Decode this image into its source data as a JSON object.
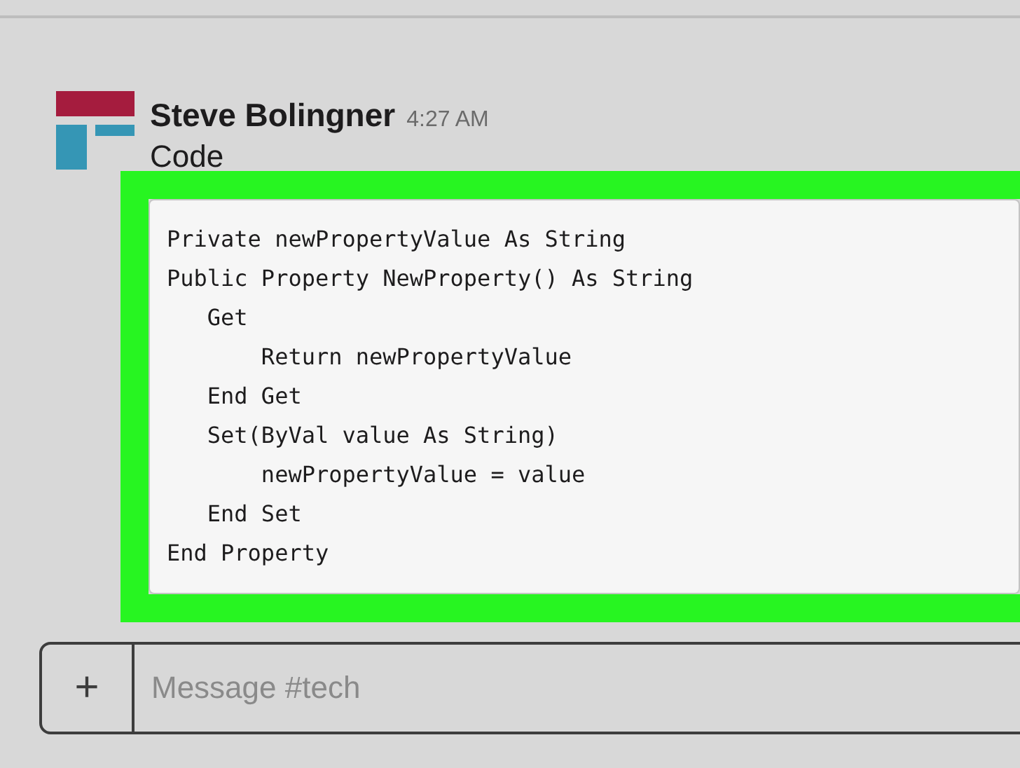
{
  "message": {
    "author": "Steve Bolingner",
    "time": "4:27 AM",
    "text": "Code",
    "code_lines": [
      "Private newPropertyValue As String",
      "Public Property NewProperty() As String",
      "   Get",
      "       Return newPropertyValue",
      "   End Get",
      "   Set(ByVal value As String)",
      "       newPropertyValue = value",
      "   End Set",
      "End Property"
    ],
    "highlighted": true
  },
  "composer": {
    "button": "+",
    "placeholder": "Message #tech"
  }
}
